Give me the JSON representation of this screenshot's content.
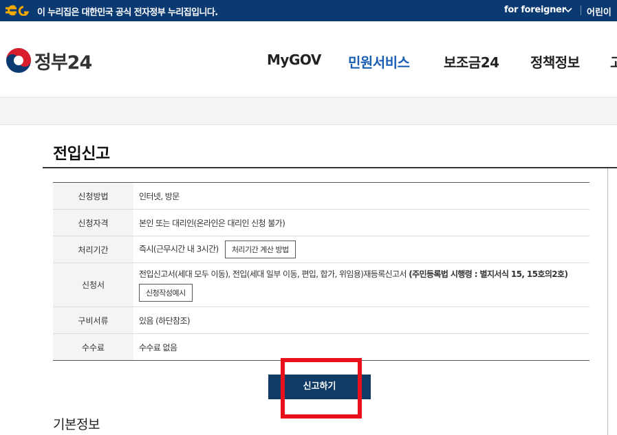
{
  "topbar": {
    "notice": "이 누리집은 대한민국 공식 전자정부 누리집입니다.",
    "foreigner": "for foreigner",
    "kids": "어린이"
  },
  "header": {
    "logo_text": "정부24",
    "nav": [
      "MyGOV",
      "민원서비스",
      "보조금24",
      "정책정보"
    ],
    "nav_cut": "고"
  },
  "page": {
    "title": "전입신고",
    "rows": [
      {
        "label": "신청방법",
        "value": "인터넷, 방문"
      },
      {
        "label": "신청자격",
        "value": "본인 또는 대리인(온라인은 대리인 신청 불가)"
      },
      {
        "label": "처리기간",
        "value": "즉시(근무시간 내 3시간)",
        "button": "처리기간 계산 방법"
      },
      {
        "label": "신청서",
        "value": "전입신고서(세대 모두 이동), 전입(세대 일부 이동, 편입, 합가, 위임용)재등록신고서 ",
        "value_bold": "(주민등록법 시행령 : 별지서식 15, 15호의2호)",
        "button": "신청작성예시"
      },
      {
        "label": "구비서류",
        "value": "있음 (하단참조)"
      },
      {
        "label": "수수료",
        "value": "수수료 없음"
      }
    ],
    "submit_label": "신고하기",
    "basic_info": "기본정보"
  },
  "colors": {
    "topbar_bg": "#0b3a73",
    "nav_active": "#1a5fb4",
    "submit_bg": "#0f3b66",
    "highlight": "#e8101b"
  }
}
